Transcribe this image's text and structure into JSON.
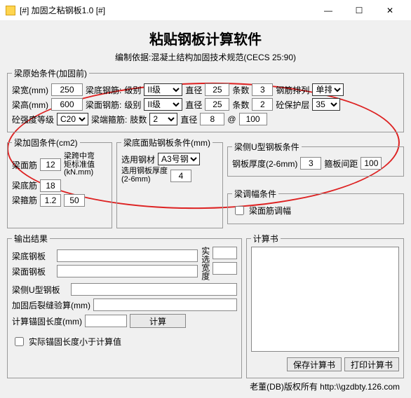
{
  "titlebar": {
    "title": "[#] 加固之粘钢板1.0 [#]"
  },
  "header": {
    "title": "粘贴钢板计算软件",
    "subtitle": "编制依据:混凝土结构加固技术规范(CECS 25:90)"
  },
  "orig": {
    "legend": "梁原始条件(加固前)",
    "r1": {
      "bw_label": "梁宽(mm)",
      "bw": "250",
      "bottom_label": "梁底钢筋:",
      "grade_label": "级别",
      "grade": "II级",
      "dia_label": "直径",
      "dia": "25",
      "num_label": "条数",
      "num": "3",
      "arrange_label": "钢筋排列",
      "arrange": "单排"
    },
    "r2": {
      "bh_label": "梁高(mm)",
      "bh": "600",
      "face_label": "梁面钢筋:",
      "grade_label": "级别",
      "grade": "II级",
      "dia_label": "直径",
      "dia": "25",
      "num_label": "条数",
      "num": "2",
      "cover_label": "砼保护层",
      "cover": "35"
    },
    "r3": {
      "cg_label": "砼强度等级",
      "cg": "C20",
      "stir_label": "梁端箍筋:",
      "legs_label": "肢数",
      "legs": "2",
      "dia_label": "直径",
      "dia": "8",
      "at": "@",
      "spacing": "100"
    }
  },
  "reinf": {
    "legend": "梁加固条件(cm2)",
    "top_label": "梁面筋",
    "top": "12",
    "bot_label": "梁底筋",
    "bot": "18",
    "stir_label": "梁箍筋",
    "stir": "1.2",
    "stir2": "50",
    "moment_label1": "梁跨中弯",
    "moment_label2": "矩标准值",
    "moment_label3": "(kN.mm)"
  },
  "plate": {
    "legend": "梁底面贴钢板条件(mm)",
    "steel_label": "选用钢材",
    "steel": "A3号钢",
    "thick_label1": "选用钢板厚度",
    "thick_label2": "(2-6mm)",
    "thick": "4"
  },
  "uplate": {
    "legend": "梁侧U型钢板条件",
    "thick_label": "钢板厚度(2-6mm)",
    "thick": "3",
    "sp_label": "箍板间距",
    "sp": "100"
  },
  "adjust": {
    "legend": "梁调幅条件",
    "cb_label": "梁面筋调幅"
  },
  "output": {
    "legend": "输出结果",
    "r1": "梁底钢板",
    "real_label": "实选宽度",
    "r2": "梁面钢板",
    "r3": "梁侧U型钢板",
    "r4": "加固后裂缝验算(mm)",
    "r5": "计算锚固长度(mm)",
    "calc_btn": "计算",
    "cb_label": "实际锚固长度小于计算值"
  },
  "calc": {
    "legend": "计算书",
    "save_btn": "保存计算书",
    "print_btn": "打印计算书"
  },
  "footer": "老董(DB)版权所有 http:\\\\gzdbty.126.com"
}
